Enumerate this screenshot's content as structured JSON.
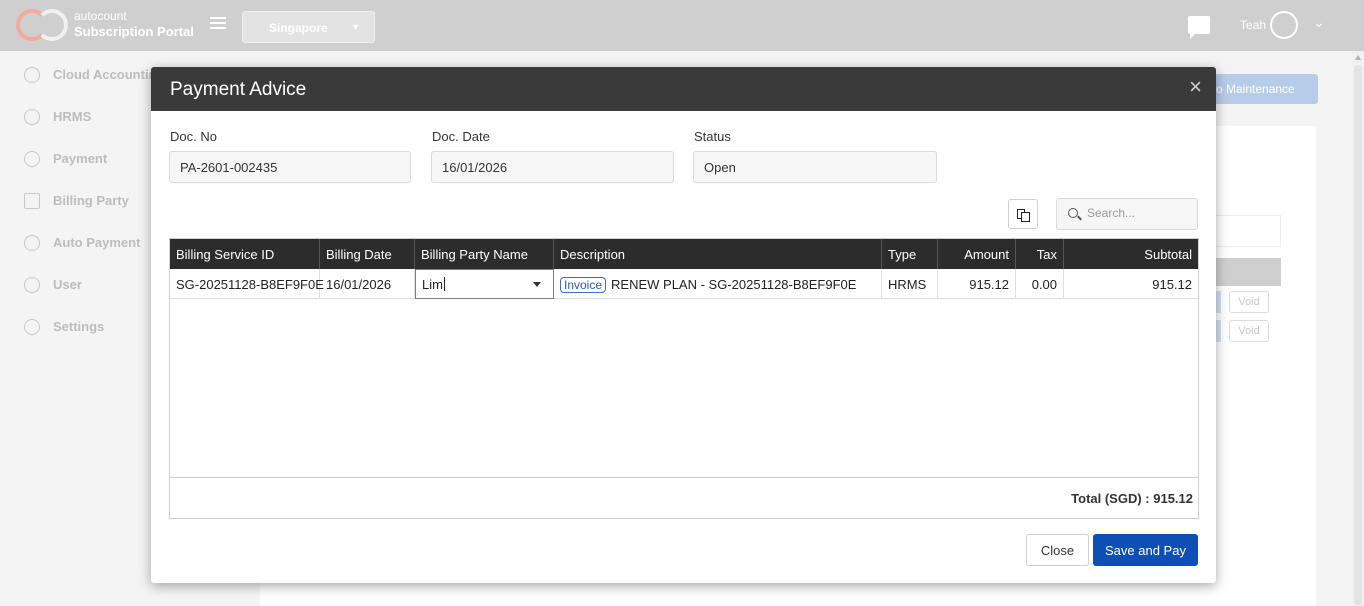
{
  "app": {
    "brand_line1": "autocount",
    "brand_line2": "Subscription Portal",
    "region": "Singapore",
    "user_name": "Teah"
  },
  "sidebar": {
    "items": [
      {
        "label": "Cloud Accounting",
        "icon": "cloud-icon"
      },
      {
        "label": "HRMS",
        "icon": "hrms-icon"
      },
      {
        "label": "Payment",
        "icon": "payment-icon"
      },
      {
        "label": "Billing Party",
        "icon": "billing-party-icon"
      },
      {
        "label": "Auto Payment",
        "icon": "auto-payment-icon"
      },
      {
        "label": "User",
        "icon": "user-icon"
      },
      {
        "label": "Settings",
        "icon": "settings-icon"
      }
    ]
  },
  "background": {
    "maintenance_button": "o Maintenance",
    "void_label": "Void"
  },
  "modal": {
    "title": "Payment Advice",
    "close_symbol": "×",
    "fields": {
      "doc_no_label": "Doc. No",
      "doc_no_value": "PA-2601-002435",
      "doc_date_label": "Doc. Date",
      "doc_date_value": "16/01/2026",
      "status_label": "Status",
      "status_value": "Open"
    },
    "search_placeholder": "Search...",
    "table": {
      "columns": [
        "Billing Service ID",
        "Billing Date",
        "Billing Party Name",
        "Description",
        "Type",
        "Amount",
        "Tax",
        "Subtotal"
      ],
      "rows": [
        {
          "billing_service_id": "SG-20251128-B8EF9F0E",
          "billing_date": "16/01/2026",
          "billing_party_name": "Lim",
          "description_badge": "Invoice",
          "description": "RENEW PLAN - SG-20251128-B8EF9F0E",
          "type": "HRMS",
          "amount": "915.12",
          "tax": "0.00",
          "subtotal": "915.12"
        }
      ],
      "total": "Total (SGD) : 915.12"
    },
    "buttons": {
      "close": "Close",
      "save_and_pay": "Save and Pay"
    }
  }
}
